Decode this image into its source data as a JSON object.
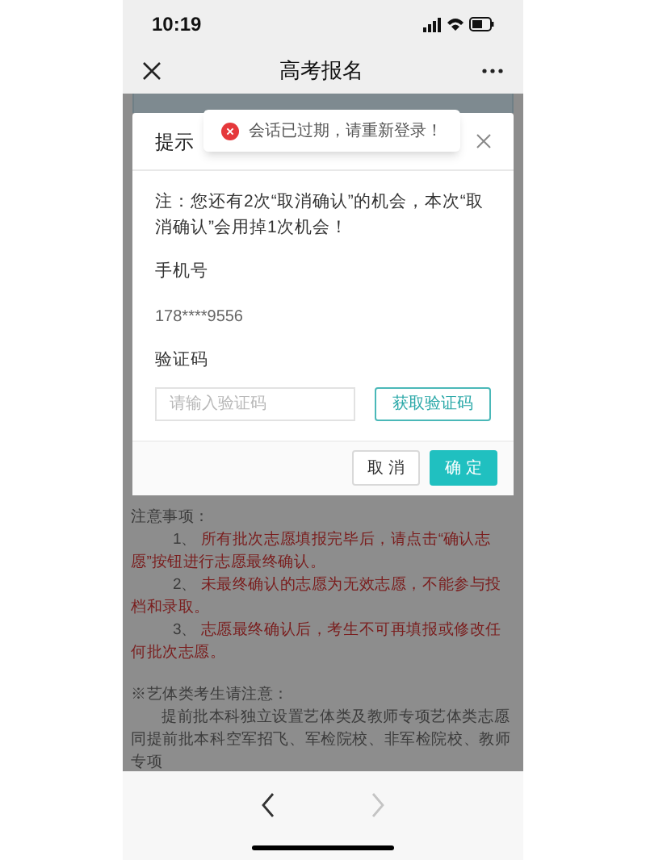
{
  "status_bar": {
    "time": "10:19"
  },
  "nav_bar": {
    "title": "高考报名"
  },
  "toast": {
    "kind": "error",
    "message": "会话已过期，请重新登录！"
  },
  "dialog": {
    "title": "提示",
    "note": "注：您还有2次“取消确认”的机会，本次“取消确认”会用掉1次机会！",
    "phone_label": "手机号",
    "phone_value": "178****9556",
    "code_label": "验证码",
    "code_field": {
      "placeholder": "请输入验证码"
    },
    "get_code_button": "获取验证码",
    "cancel_button": "取 消",
    "confirm_button": "确 定"
  },
  "notes": {
    "heading": "注意事项：",
    "items": [
      {
        "number": "1、",
        "text": "所有批次志愿填报完毕后，请点击“确认志愿”按钮进行志愿最终确认。"
      },
      {
        "number": "2、",
        "text": "未最终确认的志愿为无效志愿，不能参与投档和录取。"
      },
      {
        "number": "3、",
        "text": "志愿最终确认后，考生不可再填报或修改任何批次志愿。"
      }
    ],
    "art_heading": "※艺体类考生请注意：",
    "art_paragraph": "提前批本科独立设置艺体类及教师专项艺体类志愿同提前批本科空军招飞、军检院校、非军检院校、教师专项"
  },
  "bottom_nav": {
    "back": {
      "disabled": false
    },
    "forward": {
      "disabled": true
    }
  }
}
